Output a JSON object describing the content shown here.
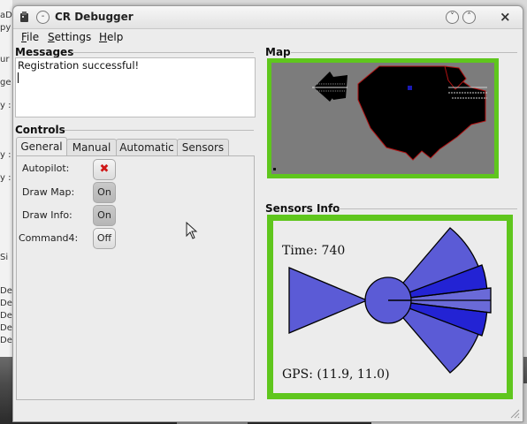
{
  "background": {
    "left_fragments": [
      "aDe",
      "py",
      "ur",
      "ge",
      "y :",
      "y :",
      "y :",
      "Si",
      "De",
      "De",
      "De",
      "De",
      "De"
    ]
  },
  "window": {
    "title": "CR Debugger",
    "title_buttons": {
      "pin": "-",
      "minimize": "˅",
      "maximize": "˄",
      "close": "×"
    }
  },
  "menu": [
    {
      "label": "File",
      "key": "F",
      "rest": "ile"
    },
    {
      "label": "Settings",
      "key": "S",
      "rest": "ettings"
    },
    {
      "label": "Help",
      "key": "H",
      "rest": "elp"
    }
  ],
  "messages": {
    "title": "Messages",
    "text": "Registration successful!"
  },
  "controls": {
    "title": "Controls",
    "tabs": [
      "General",
      "Manual",
      "Automatic",
      "Sensors"
    ],
    "active_tab": "General",
    "items": [
      {
        "label": "Autopilot:",
        "value": "✖",
        "state": "off-icon"
      },
      {
        "label": "Draw Map:",
        "value": "On",
        "state": "on"
      },
      {
        "label": "Draw Info:",
        "value": "On",
        "state": "on"
      },
      {
        "label": "Command4:",
        "value": "Off",
        "state": "off"
      }
    ]
  },
  "map": {
    "title": "Map",
    "frame_color": "#5fc61d",
    "background_color": "#7c7c7c"
  },
  "sensors": {
    "title": "Sensors Info",
    "time_text": "Time: 740",
    "gps_text": "GPS: (11.9, 11.0)",
    "sensor_color": "#5b5bd6",
    "highlight_color": "#2323d4"
  }
}
